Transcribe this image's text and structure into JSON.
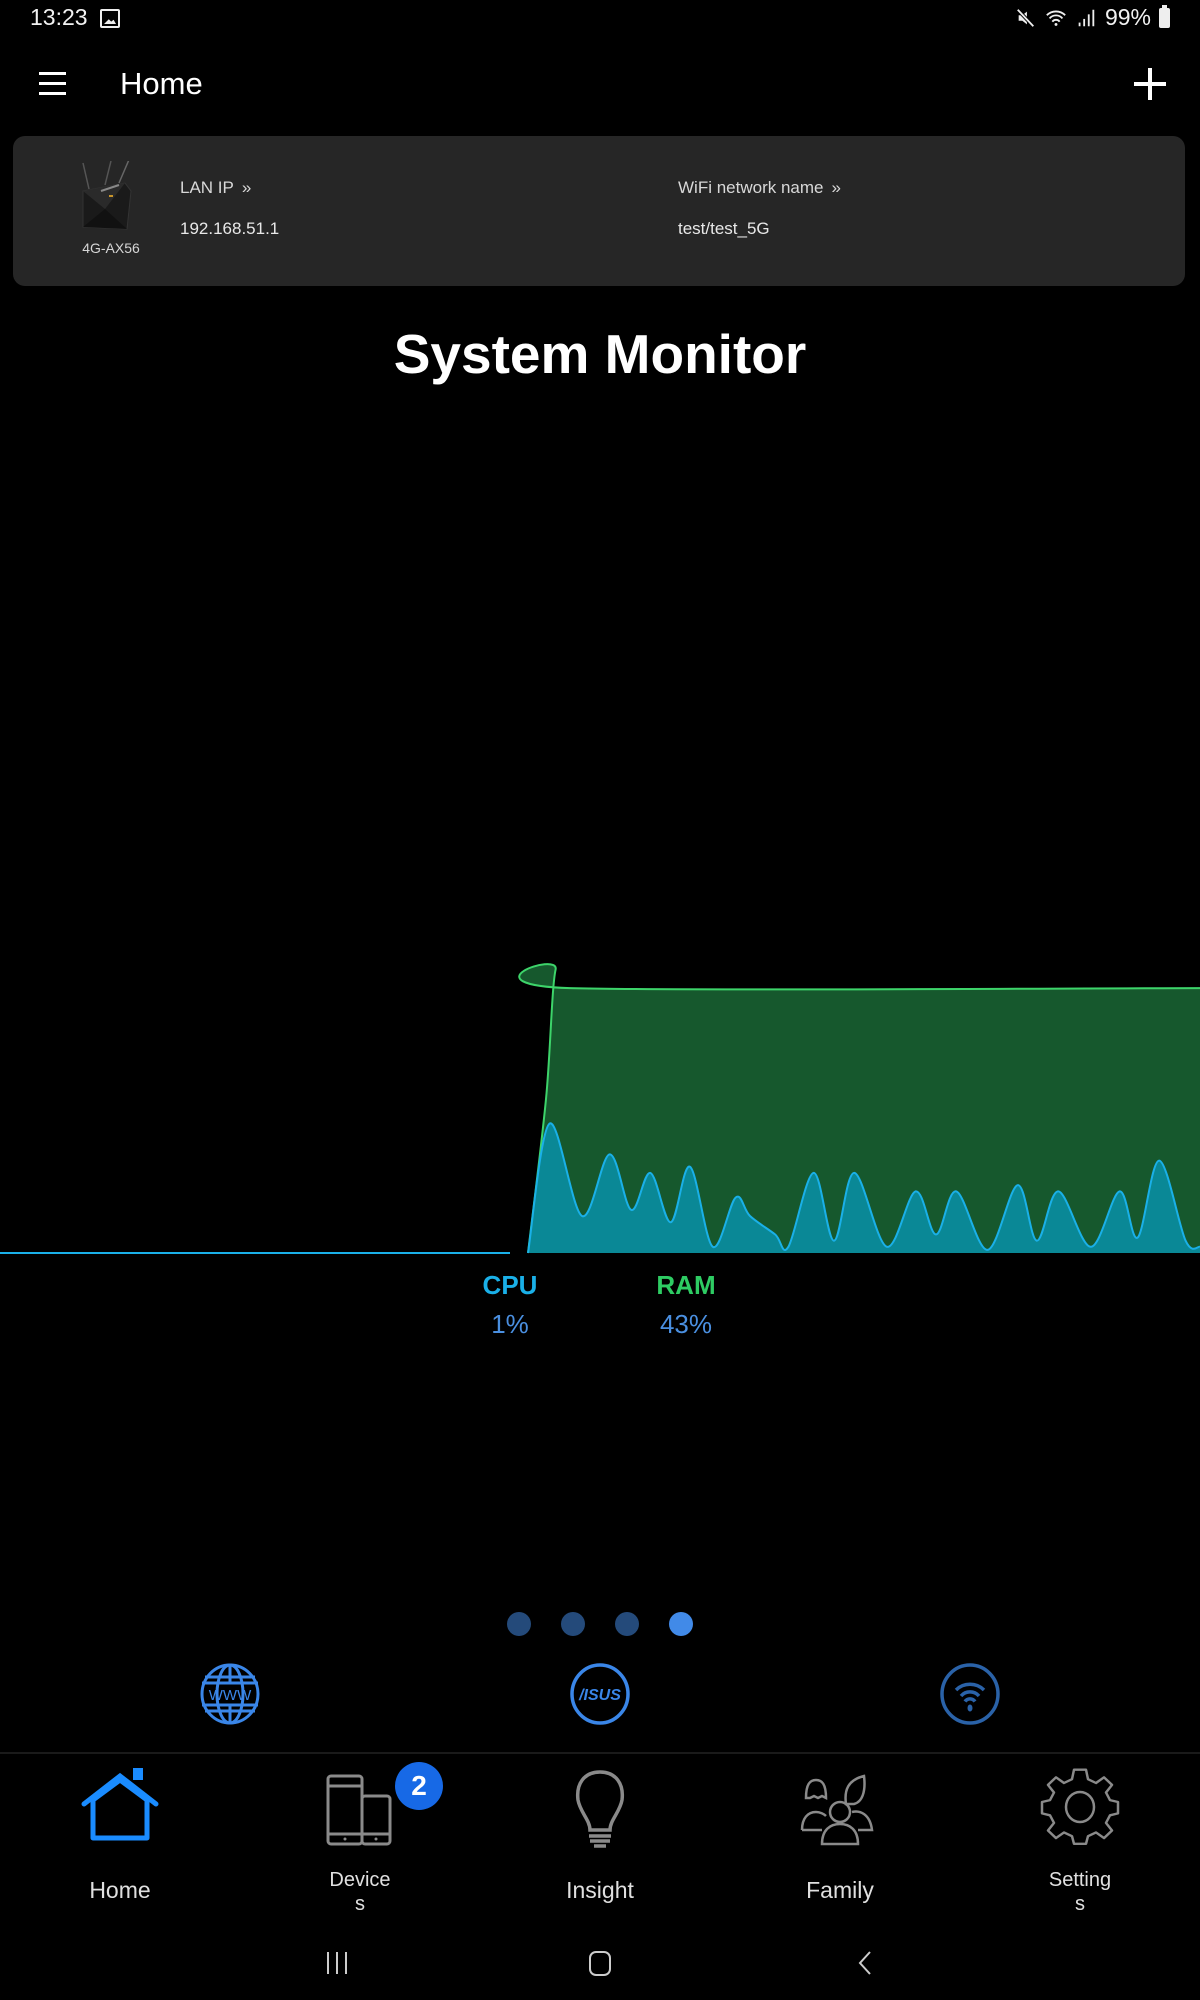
{
  "status_bar": {
    "time": "13:23",
    "battery": "99%",
    "icons": [
      "gallery-icon",
      "mute-icon",
      "wifi-icon",
      "signal-icon",
      "battery-icon"
    ]
  },
  "app_bar": {
    "title": "Home",
    "menu_icon": "hamburger-menu-icon",
    "add_icon": "plus-icon"
  },
  "router_card": {
    "model": "4G-AX56",
    "lan_ip_label": "LAN IP",
    "lan_ip_value": "192.168.51.1",
    "wifi_label": "WiFi network name",
    "wifi_value": "test/test_5G",
    "chevron": "»"
  },
  "monitor": {
    "title": "System Monitor",
    "cpu_label": "CPU",
    "cpu_value": "1%",
    "ram_label": "RAM",
    "ram_value": "43%",
    "colors": {
      "cpu_line": "#1ab0e8",
      "cpu_fill": "#0a8896",
      "ram_line": "#3dd46a",
      "ram_fill": "#16582d",
      "cpu_label": "#1ab0e8",
      "ram_label": "#2ecc63",
      "value_text": "#4a8fe0"
    }
  },
  "chart_data": {
    "type": "area",
    "title": "System Monitor",
    "xlabel": "",
    "ylabel": "",
    "xlim": [
      0,
      100
    ],
    "ylim": [
      0,
      100
    ],
    "grid": false,
    "legend": "bottom-center",
    "series": [
      {
        "name": "RAM",
        "unit": "%",
        "points": [
          [
            44,
            0
          ],
          [
            45.5,
            25
          ],
          [
            46.3,
            46
          ],
          [
            47.5,
            43
          ],
          [
            100,
            43
          ]
        ]
      },
      {
        "name": "CPU",
        "unit": "%",
        "points": [
          [
            0,
            0
          ],
          [
            42.5,
            0
          ],
          [
            44,
            0
          ],
          [
            45.8,
            21
          ],
          [
            48.5,
            6
          ],
          [
            50.8,
            16
          ],
          [
            52.6,
            7
          ],
          [
            54.2,
            13
          ],
          [
            55.9,
            5
          ],
          [
            57.5,
            14
          ],
          [
            59.4,
            1
          ],
          [
            61.3,
            9
          ],
          [
            62.5,
            6
          ],
          [
            64.6,
            3
          ],
          [
            65.7,
            1
          ],
          [
            67.8,
            13
          ],
          [
            69.5,
            2
          ],
          [
            71.2,
            13
          ],
          [
            73.9,
            1
          ],
          [
            76.3,
            10
          ],
          [
            78,
            3
          ],
          [
            79.7,
            10
          ],
          [
            82.3,
            0.5
          ],
          [
            84.8,
            11
          ],
          [
            86.4,
            2
          ],
          [
            88.2,
            10
          ],
          [
            90.9,
            1
          ],
          [
            93.3,
            10
          ],
          [
            94.8,
            2.5
          ],
          [
            96.6,
            15
          ],
          [
            98.8,
            2
          ],
          [
            100,
            1
          ]
        ]
      }
    ]
  },
  "pager": {
    "count": 4,
    "active_index": 3
  },
  "quick_actions": [
    {
      "name": "internet",
      "icon": "globe-www-icon",
      "text": "WWW"
    },
    {
      "name": "asus",
      "icon": "asus-logo-icon",
      "text": "/ISUS"
    },
    {
      "name": "wifi",
      "icon": "wifi-icon"
    }
  ],
  "bottom_nav": {
    "items": [
      {
        "label": "Home",
        "icon": "home-icon",
        "active": true
      },
      {
        "label": "Devices",
        "label_line1": "Device",
        "label_line2": "s",
        "icon": "devices-icon",
        "badge": "2"
      },
      {
        "label": "Insight",
        "icon": "lightbulb-icon"
      },
      {
        "label": "Family",
        "icon": "family-icon"
      },
      {
        "label": "Settings",
        "label_line1": "Setting",
        "label_line2": "s",
        "icon": "gear-icon"
      }
    ],
    "active_color": "#1a8cff",
    "inactive_color": "#8a8a8a"
  },
  "system_nav": {
    "recent": "recent-apps-icon",
    "home": "home-circle-icon",
    "back": "back-icon"
  }
}
